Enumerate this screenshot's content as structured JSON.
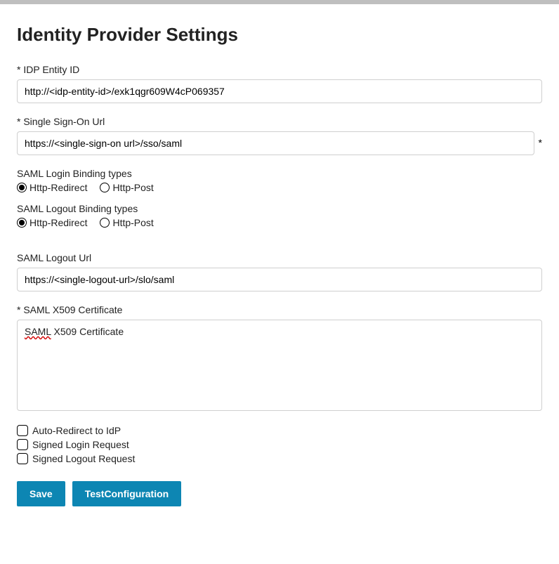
{
  "page": {
    "title": "Identity Provider Settings"
  },
  "fields": {
    "idp_entity_id": {
      "label": "* IDP Entity ID",
      "value": "http://<idp-entity-id>/exk1qgr609W4cP069357"
    },
    "sso_url": {
      "label": "*  Single Sign-On Url",
      "value": "https://<single-sign-on url>/sso/saml",
      "trailing_star": "*"
    },
    "login_binding": {
      "label": "SAML Login Binding types",
      "options": [
        "Http-Redirect",
        "Http-Post"
      ],
      "selected": "Http-Redirect"
    },
    "logout_binding": {
      "label": "SAML Logout Binding types",
      "options": [
        "Http-Redirect",
        "Http-Post"
      ],
      "selected": "Http-Redirect"
    },
    "logout_url": {
      "label": "SAML Logout Url",
      "value": "https://<single-logout-url>/slo/saml"
    },
    "x509_cert": {
      "label": "* SAML X509 Certificate",
      "value_prefix": "SAML",
      "value_rest": " X509 Certificate"
    },
    "checkboxes": {
      "auto_redirect": {
        "label": "Auto-Redirect to IdP",
        "checked": false
      },
      "signed_login": {
        "label": "Signed Login Request",
        "checked": false
      },
      "signed_logout": {
        "label": "Signed Logout Request",
        "checked": false
      }
    }
  },
  "buttons": {
    "save": "Save",
    "test": "TestConfiguration"
  }
}
